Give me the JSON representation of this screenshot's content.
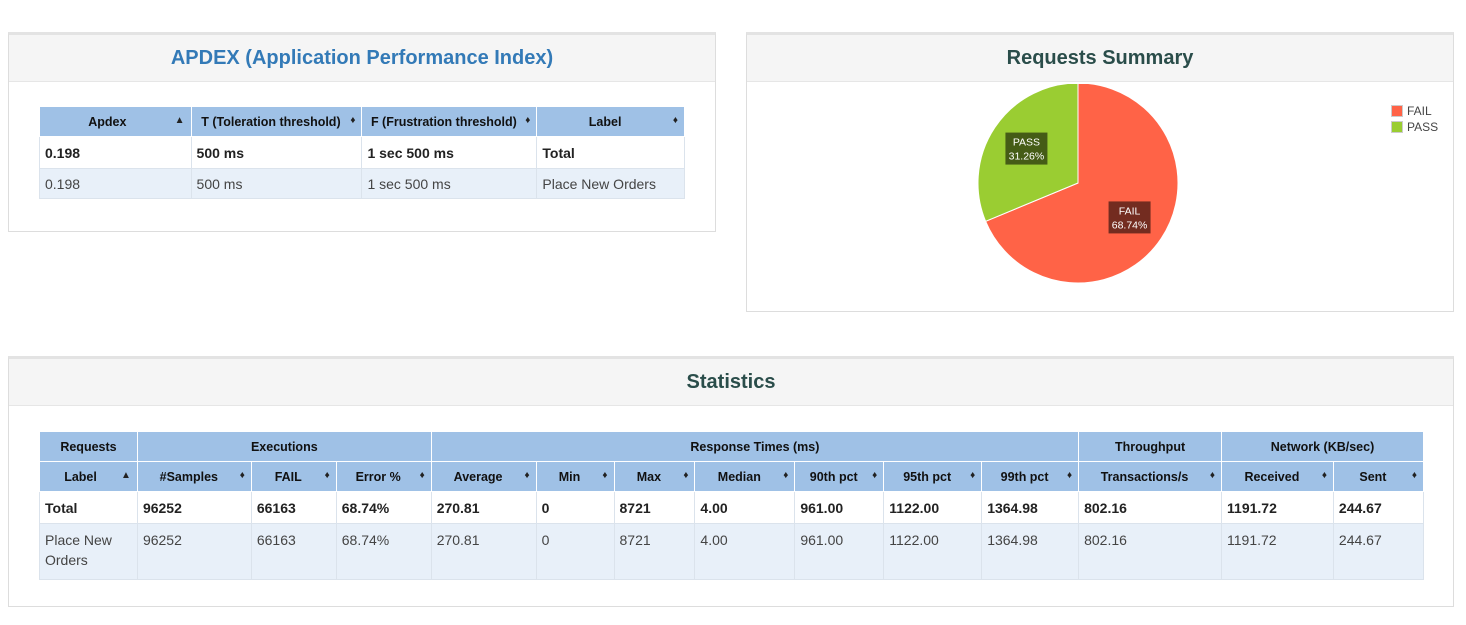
{
  "apdex": {
    "title": "APDEX (Application Performance Index)",
    "columns": [
      "Apdex",
      "T (Toleration threshold)",
      "F (Frustration threshold)",
      "Label"
    ],
    "total": [
      "0.198",
      "500 ms",
      "1 sec 500 ms",
      "Total"
    ],
    "rows": [
      [
        "0.198",
        "500 ms",
        "1 sec 500 ms",
        "Place New Orders"
      ]
    ]
  },
  "summary": {
    "title": "Requests Summary",
    "legend": [
      {
        "label": "FAIL",
        "color": "#ff6347"
      },
      {
        "label": "PASS",
        "color": "#9acd32"
      }
    ]
  },
  "chart_data": {
    "type": "pie",
    "title": "Requests Summary",
    "slices": [
      {
        "label": "FAIL",
        "value": 68.74,
        "display": "68.74%",
        "color": "#ff6347"
      },
      {
        "label": "PASS",
        "value": 31.26,
        "display": "31.26%",
        "color": "#9acd32"
      }
    ],
    "legend_position": "top-right"
  },
  "stats": {
    "title": "Statistics",
    "groups": [
      "Requests",
      "Executions",
      "Response Times (ms)",
      "Throughput",
      "Network (KB/sec)"
    ],
    "columns": [
      "Label",
      "#Samples",
      "FAIL",
      "Error %",
      "Average",
      "Min",
      "Max",
      "Median",
      "90th pct",
      "95th pct",
      "99th pct",
      "Transactions/s",
      "Received",
      "Sent"
    ],
    "total": [
      "Total",
      "96252",
      "66163",
      "68.74%",
      "270.81",
      "0",
      "8721",
      "4.00",
      "961.00",
      "1122.00",
      "1364.98",
      "802.16",
      "1191.72",
      "244.67"
    ],
    "rows": [
      [
        "Place New Orders",
        "96252",
        "66163",
        "68.74%",
        "270.81",
        "0",
        "8721",
        "4.00",
        "961.00",
        "1122.00",
        "1364.98",
        "802.16",
        "1191.72",
        "244.67"
      ]
    ]
  }
}
